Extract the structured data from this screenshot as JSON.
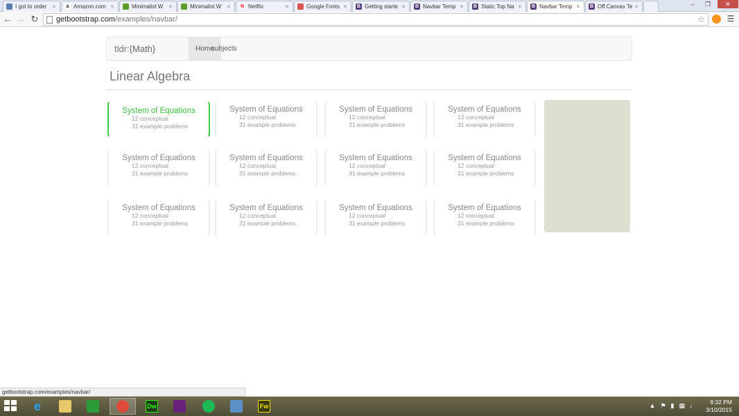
{
  "browser": {
    "tabs": [
      {
        "label": "I got to order",
        "icon": "globe-icon",
        "color": "#5b7bb5",
        "glyph": ""
      },
      {
        "label": "Amazon.com",
        "icon": "amazon-icon",
        "color": "#ffffff",
        "glyph": "a"
      },
      {
        "label": "Minimalist W",
        "icon": "green-app-icon",
        "color": "#5c9e2a",
        "glyph": ""
      },
      {
        "label": "Minimalist W",
        "icon": "green-app-icon",
        "color": "#5c9e2a",
        "glyph": ""
      },
      {
        "label": "Netflix",
        "icon": "netflix-icon",
        "color": "#ffffff",
        "glyph": "N"
      },
      {
        "label": "Google Fonts",
        "icon": "google-fonts-icon",
        "color": "#d9534f",
        "glyph": ""
      },
      {
        "label": "Getting starte",
        "icon": "bootstrap-icon",
        "color": "#563d7c",
        "glyph": "B"
      },
      {
        "label": "Navbar Temp",
        "icon": "bootstrap-icon",
        "color": "#563d7c",
        "glyph": "B"
      },
      {
        "label": "Static Top Na",
        "icon": "bootstrap-icon",
        "color": "#563d7c",
        "glyph": "B"
      },
      {
        "label": "Navbar Temp",
        "icon": "bootstrap-icon",
        "color": "#563d7c",
        "glyph": "B",
        "active": true
      },
      {
        "label": "Off Canvas Te",
        "icon": "bootstrap-icon",
        "color": "#563d7c",
        "glyph": "B"
      }
    ],
    "url_host": "getbootstrap.com",
    "url_path": "/examples/navbar/",
    "status_url": "getbootstrap.com/examples/navbar/"
  },
  "site": {
    "brand_prefix": "tldr:",
    "brand_main": "{Math}",
    "nav": {
      "home": "Home",
      "subjects": "subjects"
    },
    "section_title": "Linear Algebra",
    "accent_color": "#3dbd3d",
    "cards": [
      {
        "title": "System of Equations",
        "line1": "12 conceptual",
        "line2": "31 example problems",
        "active": true
      },
      {
        "title": "System of Equations",
        "line1": "12 conceptual",
        "line2": "31 example problems"
      },
      {
        "title": "System of Equations",
        "line1": "12 conceptual",
        "line2": "31 example problems"
      },
      {
        "title": "System of Equations",
        "line1": "12 conceptual",
        "line2": "31 example problems"
      },
      {
        "title": "System of Equations",
        "line1": "12 conceptual",
        "line2": "31 example problems"
      },
      {
        "title": "System of Equations",
        "line1": "12 conceptual",
        "line2": "31 example problems"
      },
      {
        "title": "System of Equations",
        "line1": "12 conceptual",
        "line2": "31 example problems"
      },
      {
        "title": "System of Equations",
        "line1": "12 conceptual",
        "line2": "31 example problems"
      },
      {
        "title": "System of Equations",
        "line1": "12 conceptual",
        "line2": "31 example problems"
      },
      {
        "title": "System of Equations",
        "line1": "12 conceptual",
        "line2": "31 example problems"
      },
      {
        "title": "System of Equations",
        "line1": "12 conceptual",
        "line2": "31 example problems"
      },
      {
        "title": "System of Equations",
        "line1": "12 conceptual",
        "line2": "31 example problems"
      }
    ]
  },
  "taskbar": {
    "apps": [
      {
        "name": "internet-explorer-icon",
        "glyph": "e",
        "color": "#1e90ff"
      },
      {
        "name": "file-explorer-icon",
        "glyph": "",
        "color": "#e8c66a"
      },
      {
        "name": "store-icon",
        "glyph": "",
        "color": "#2a9d3a"
      },
      {
        "name": "chrome-icon",
        "glyph": "",
        "color": "#dd4b39",
        "running": true
      },
      {
        "name": "dreamweaver-icon",
        "glyph": "Dw",
        "color": "#1b3b1b"
      },
      {
        "name": "visual-studio-icon",
        "glyph": "",
        "color": "#68217a"
      },
      {
        "name": "spotify-icon",
        "glyph": "",
        "color": "#1db954"
      },
      {
        "name": "photos-icon",
        "glyph": "",
        "color": "#5a8fc8"
      },
      {
        "name": "fireworks-icon",
        "glyph": "Fw",
        "color": "#3b3b10"
      }
    ],
    "time": "8:32 PM",
    "date": "3/10/2015"
  }
}
